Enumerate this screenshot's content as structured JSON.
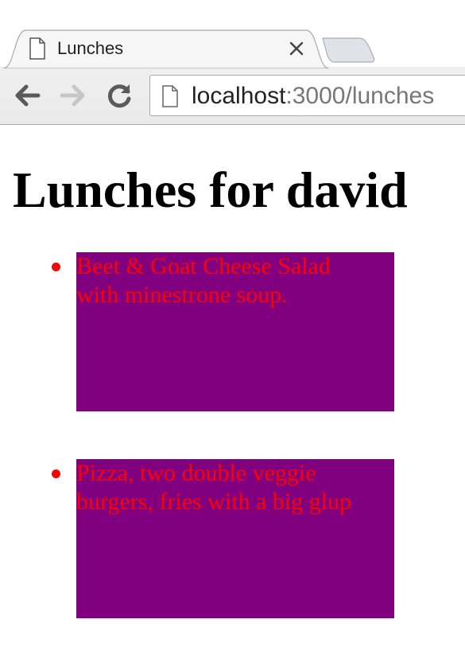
{
  "browser": {
    "tab": {
      "title": "Lunches",
      "close_glyph": "✕",
      "icon": "page-icon"
    },
    "address": {
      "host": "localhost",
      "path": ":3000/lunches",
      "icon": "page-icon"
    },
    "nav": {
      "back_icon": "back-arrow-icon",
      "forward_icon": "forward-arrow-icon",
      "reload_icon": "reload-icon"
    }
  },
  "page": {
    "heading": "Lunches for david",
    "lunches": [
      {
        "description": "Beet & Goat Cheese Salad with minestrone soup."
      },
      {
        "description": "Pizza, two double veggie burgers, fries with a big glup"
      }
    ]
  },
  "colors": {
    "item_background": "#800080",
    "item_text": "#ff0000",
    "heading": "#000000",
    "url_host": "#222222",
    "url_path": "#777777"
  }
}
